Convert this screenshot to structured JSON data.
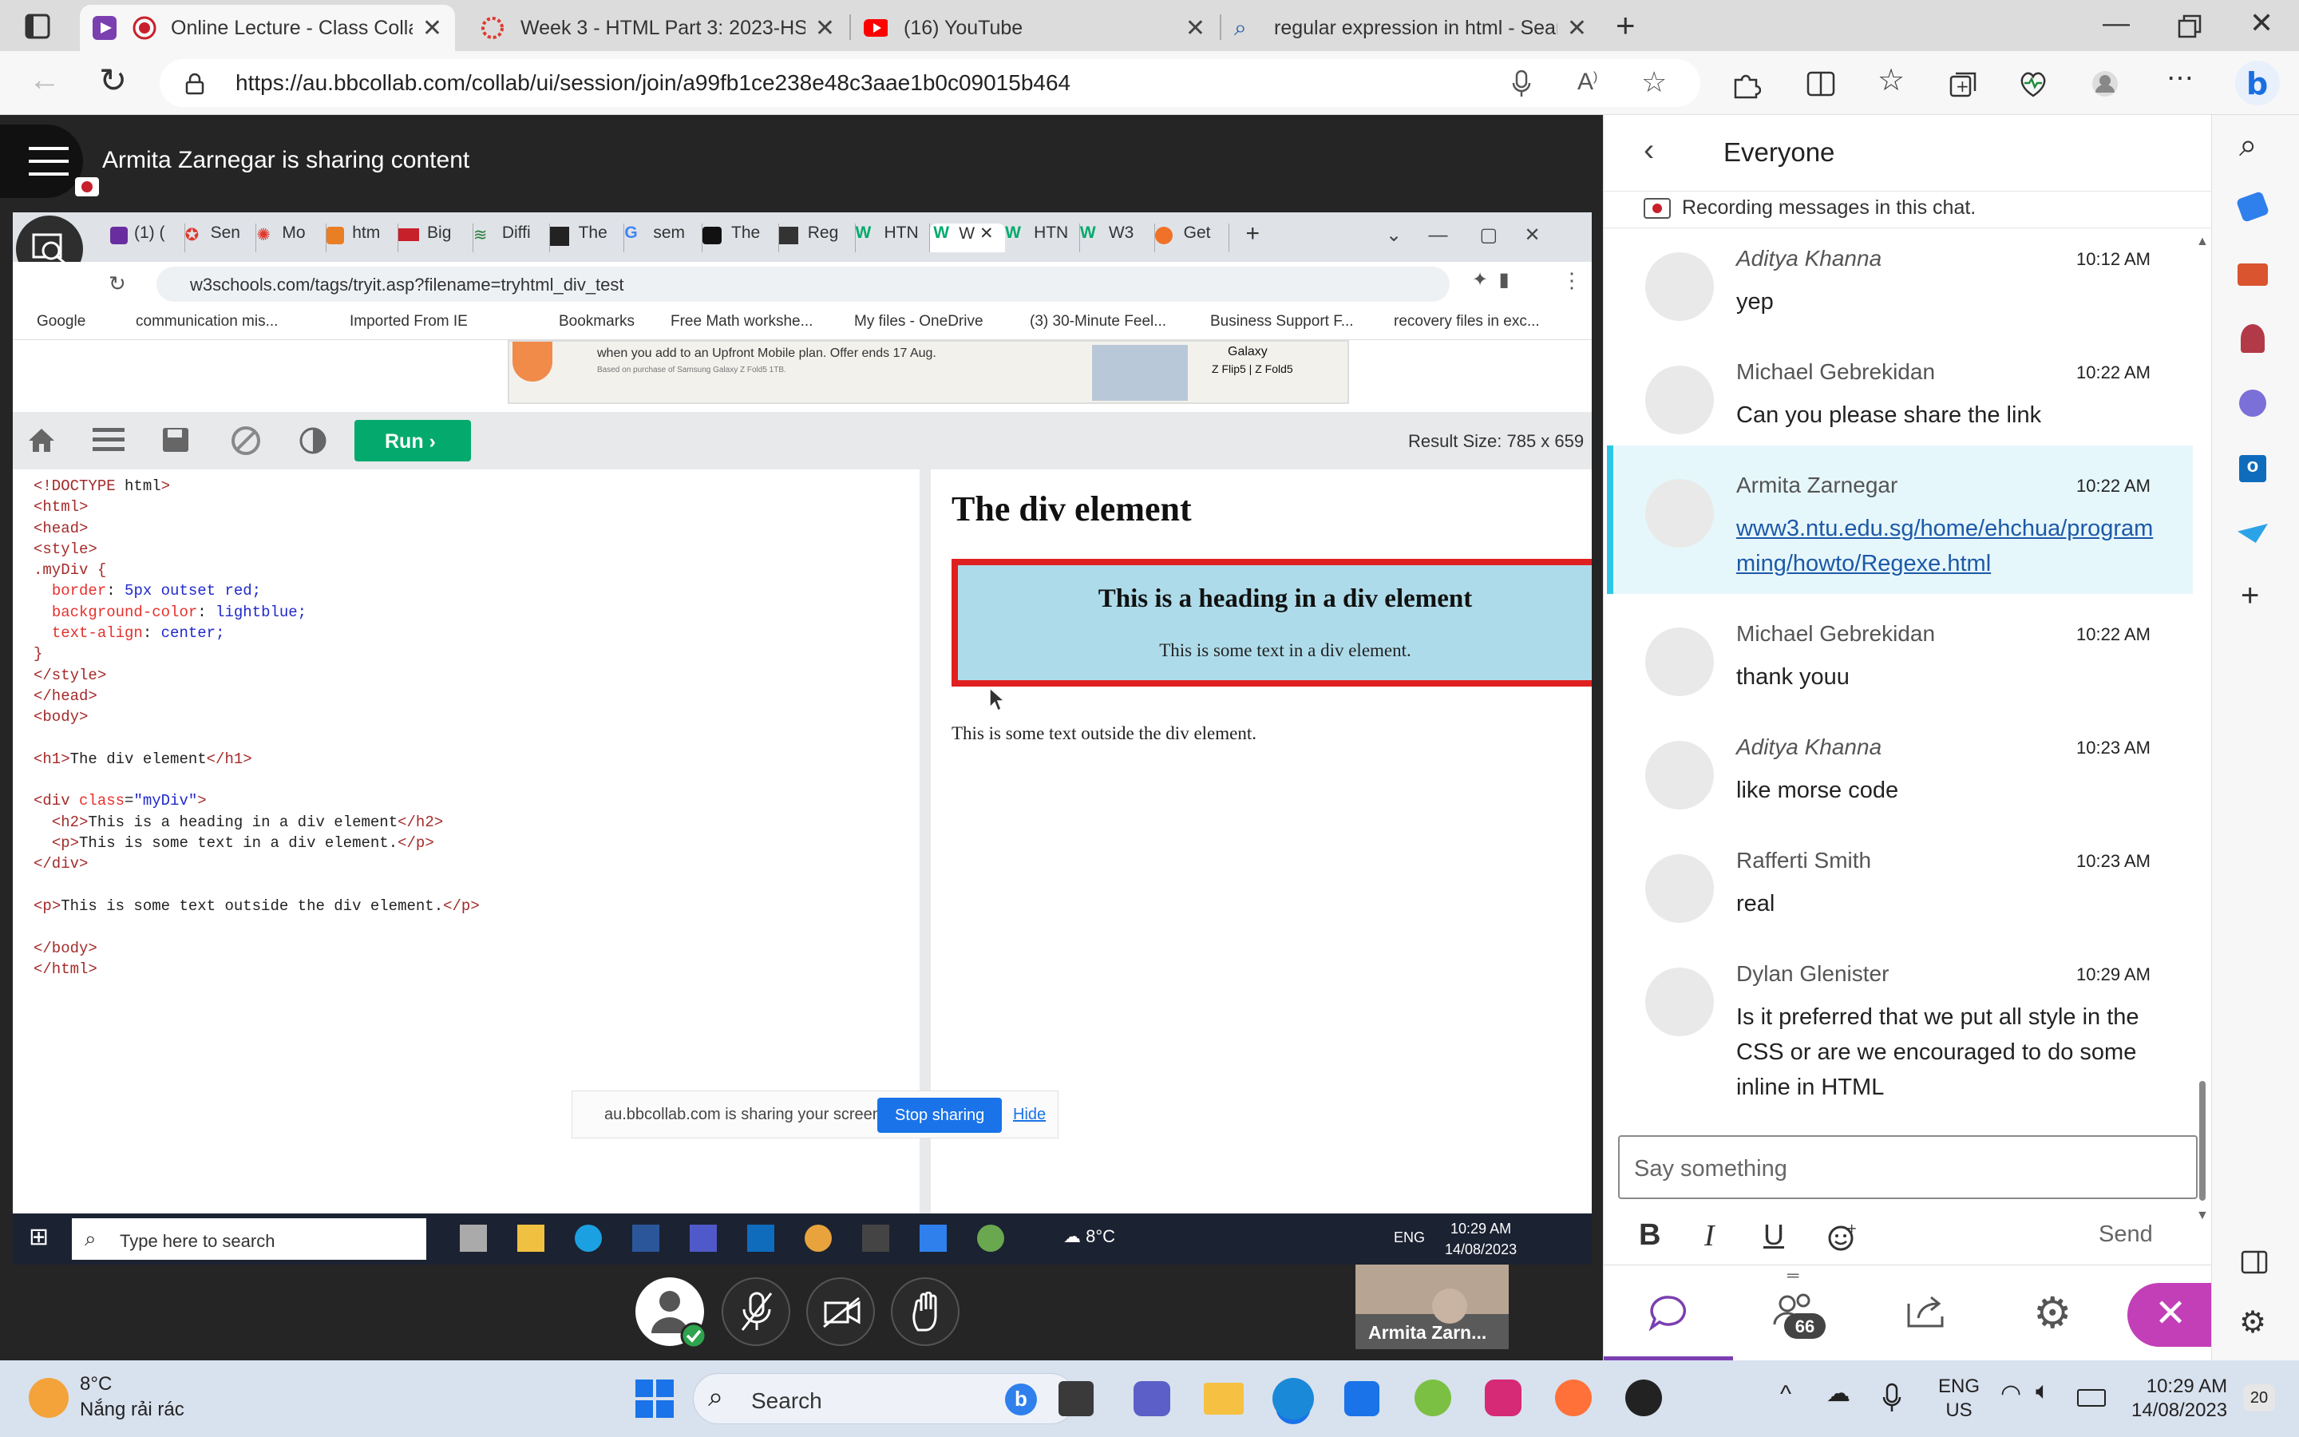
{
  "browser": {
    "tabs": [
      {
        "title": "Online Lecture - Class Collal",
        "active": true
      },
      {
        "title": "Week 3 - HTML Part 3: 2023-HS2"
      },
      {
        "title": "(16) YouTube"
      },
      {
        "title": "regular expression in html - Sear"
      }
    ],
    "url": "https://au.bbcollab.com/collab/ui/session/join/a99fb1ce238e48c3aae1b0c09015b464"
  },
  "session": {
    "sharing_title": "Armita Zarnegar is sharing content",
    "presenter_thumb": "Armita Zarn..."
  },
  "shared_screen": {
    "tabs": [
      "(1) (",
      "Sen",
      "Mo",
      "htm",
      "Big",
      "Diffi",
      "The",
      "sem",
      "The",
      "Reg",
      "HTN",
      "W",
      "HTN",
      "W3",
      "Get"
    ],
    "url": "w3schools.com/tags/tryit.asp?filename=tryhtml_div_test",
    "bookmarks": [
      "Google",
      "communication mis...",
      "Imported From IE",
      "Bookmarks",
      "Free Math workshe...",
      "My files - OneDrive",
      "(3) 30-Minute Feel...",
      "Business Support F...",
      "recovery files in exc..."
    ],
    "ad_text": "when you add to an Upfront Mobile plan. Offer ends 17 Aug.",
    "ad_small": "Based on purchase of Samsung Galaxy Z Fold5 1TB.",
    "ad_brand": "Galaxy",
    "ad_models": "Z Flip5 | Z Fold5",
    "run_label": "Run",
    "result_size": "Result Size: 785 x 659",
    "code_lines": [
      "<!DOCTYPE html>",
      "<html>",
      "<head>",
      "<style>",
      ".myDiv {",
      "  border: 5px outset red;",
      "  background-color: lightblue;",
      "  text-align: center;",
      "}",
      "</style>",
      "</head>",
      "<body>",
      "",
      "<h1>The div element</h1>",
      "",
      "<div class=\"myDiv\">",
      "  <h2>This is a heading in a div element</h2>",
      "  <p>This is some text in a div element.</p>",
      "</div>",
      "",
      "<p>This is some text outside the div element.</p>",
      "",
      "</body>",
      "</html>"
    ],
    "result": {
      "h1": "The div element",
      "h2": "This is a heading in a div element",
      "p_in": "This is some text in a div element.",
      "p_out": "This is some text outside the div element."
    },
    "share_notice": "au.bbcollab.com is sharing your screen",
    "stop_sharing": "Stop sharing",
    "hide": "Hide",
    "taskbar": {
      "search": "Type here to search",
      "weather": "8°C",
      "lang": "ENG",
      "time": "10:29 AM",
      "date": "14/08/2023"
    }
  },
  "chat": {
    "title": "Everyone",
    "recording_note": "Recording messages in this chat.",
    "messages": [
      {
        "name": "Aditya Khanna",
        "time": "10:12 AM",
        "text": "yep",
        "italic": true
      },
      {
        "name": "Michael Gebrekidan",
        "time": "10:22 AM",
        "text": "Can you please share the link"
      },
      {
        "name": "Armita Zarnegar",
        "time": "10:22 AM",
        "text": "www3.ntu.edu.sg/home/ehchua/programming/howto/Regexe.html",
        "link": true
      },
      {
        "name": "Michael Gebrekidan",
        "time": "10:22 AM",
        "text": "thank youu"
      },
      {
        "name": "Aditya Khanna",
        "time": "10:23 AM",
        "text": "like morse code",
        "italic": true
      },
      {
        "name": "Rafferti Smith",
        "time": "10:23 AM",
        "text": "real"
      },
      {
        "name": "Dylan Glenister",
        "time": "10:29 AM",
        "text": "Is it preferred that we put all style in the CSS or are we encouraged to do some inline in HTML"
      }
    ],
    "input_placeholder": "Say something",
    "send_label": "Send",
    "participants_count": "66"
  },
  "os_taskbar": {
    "weather_temp": "8°C",
    "weather_text": "Nắng rải rác",
    "search": "Search",
    "lang": "ENG",
    "region": "US",
    "time": "10:29 AM",
    "date": "14/08/2023",
    "notif_count": "20"
  }
}
